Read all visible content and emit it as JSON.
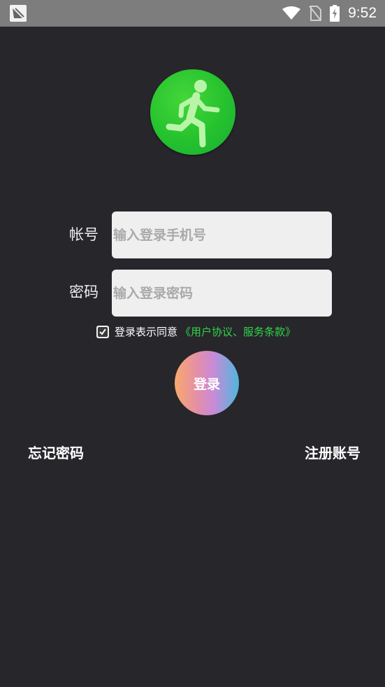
{
  "status_bar": {
    "time": "9:52",
    "icons": [
      "app-notification-icon",
      "wifi-icon",
      "no-sim-icon",
      "battery-charging-icon"
    ]
  },
  "logo": {
    "icon": "running-person-icon",
    "color": "#25c22e"
  },
  "form": {
    "account_label": "帐号",
    "account_placeholder": "输入登录手机号",
    "password_label": "密码",
    "password_placeholder": "输入登录密码"
  },
  "agreement": {
    "checked": true,
    "text": "登录表示同意",
    "link_text": "《用户协议、服务条款》",
    "link_color": "#2fd64a"
  },
  "login_button": {
    "label": "登录"
  },
  "links": {
    "forgot_password": "忘记密码",
    "register": "注册账号"
  }
}
